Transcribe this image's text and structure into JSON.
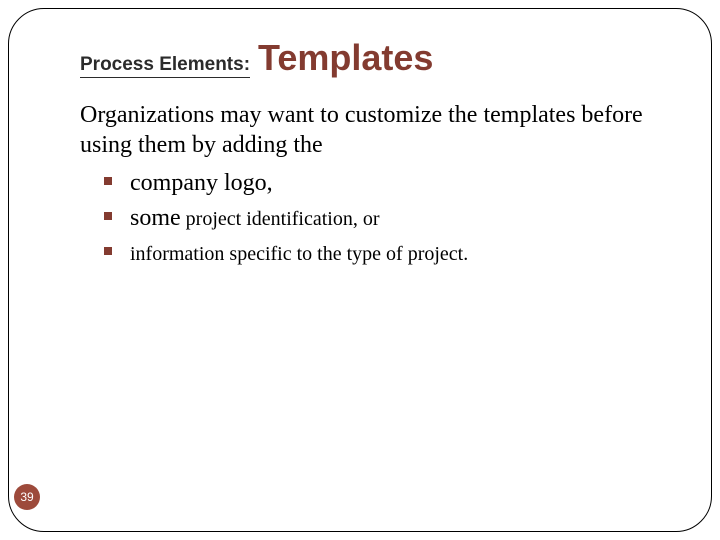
{
  "title": {
    "prefix": "Process Elements:",
    "main": "Templates"
  },
  "intro": "Organizations may want to customize the templates before using them by adding the",
  "bullets": [
    {
      "lead": "company logo,",
      "rest": ""
    },
    {
      "lead": "some",
      "rest": " project identification, or"
    },
    {
      "lead": "",
      "rest": "information specific to the type of project."
    }
  ],
  "page_number": "39"
}
